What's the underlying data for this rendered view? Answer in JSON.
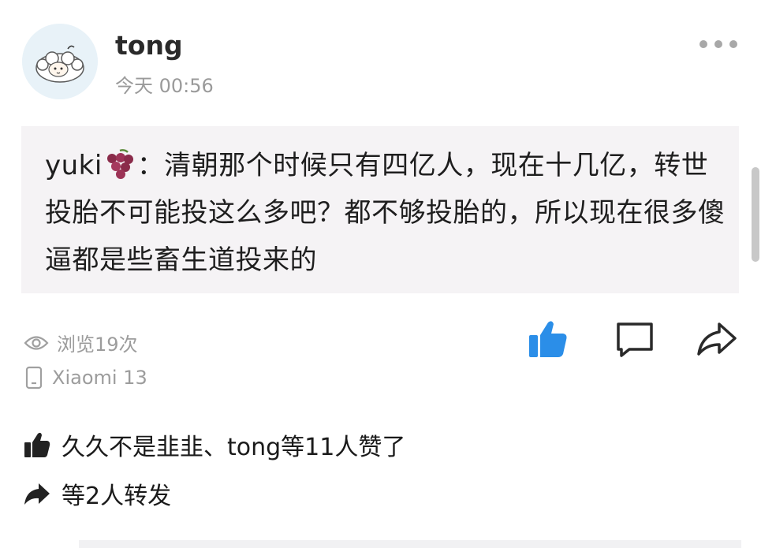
{
  "post": {
    "author": "tong",
    "timestamp": "今天 00:56",
    "avatar_icon": "sheep-avatar"
  },
  "quote": {
    "user": "yuki",
    "emoji": "grape-icon",
    "text": "：清朝那个时候只有四亿人，现在十几亿，转世投胎不可能投这么多吧？都不够投胎的，所以现在很多傻逼都是些畜生道投来的"
  },
  "meta": {
    "views": "浏览19次",
    "device": "Xiaomi 13"
  },
  "actions": {
    "like_icon": "thumbs-up-icon",
    "comment_icon": "comment-icon",
    "share_icon": "share-icon"
  },
  "summary": {
    "likes": "久久不是韭韭、tong等11人赞了",
    "shares": "等2人转发"
  },
  "colors": {
    "accent": "#2b8ee8",
    "quote_bg": "#f5f3f5",
    "muted": "#9c9c9c"
  }
}
